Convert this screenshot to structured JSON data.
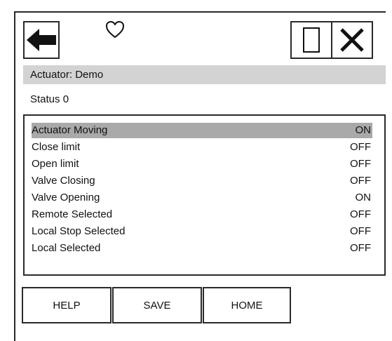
{
  "header": {
    "back_icon": "arrow-left-icon",
    "favorite_icon": "heart-outline-icon",
    "window_icon": "rectangle-icon",
    "close_icon": "close-x-icon"
  },
  "title": "Actuator: Demo",
  "status": "Status 0",
  "items": [
    {
      "label": "Actuator Moving",
      "value": "ON",
      "selected": true
    },
    {
      "label": "Close limit",
      "value": "OFF",
      "selected": false
    },
    {
      "label": "Open limit",
      "value": "OFF",
      "selected": false
    },
    {
      "label": "Valve Closing",
      "value": "OFF",
      "selected": false
    },
    {
      "label": "Valve Opening",
      "value": "ON",
      "selected": false
    },
    {
      "label": "Remote Selected",
      "value": "OFF",
      "selected": false
    },
    {
      "label": "Local Stop Selected",
      "value": "OFF",
      "selected": false
    },
    {
      "label": "Local Selected",
      "value": "OFF",
      "selected": false
    }
  ],
  "buttons": {
    "help": "HELP",
    "save": "SAVE",
    "home": "HOME"
  }
}
